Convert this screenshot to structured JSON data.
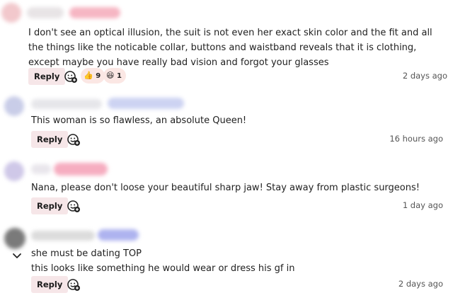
{
  "comments": [
    {
      "text": "I don't see an optical illusion, the suit is not even her exact skin color and the fit and all the things like the noticable collar, buttons and waistband reveals that it is clothing, except maybe you have really bad vision and forgot your glasses",
      "reply_label": "Reply",
      "reactions": [
        {
          "emoji": "👍",
          "count": "9",
          "icon": "thumbs-up-icon"
        },
        {
          "emoji": "😆",
          "count": "1",
          "icon": "laughing-face-icon"
        }
      ],
      "time": "2 days ago",
      "avatar_color": "#f2c8cc",
      "name_color": "#f08aa0"
    },
    {
      "text": "This woman is so flawless, an absolute Queen!",
      "reply_label": "Reply",
      "time": "16 hours ago",
      "avatar_color": "#c9cde8",
      "name_color": "#b8c0ea"
    },
    {
      "text": "Nana, please don't loose your beautiful sharp jaw! Stay away from plastic surgeons!",
      "reply_label": "Reply",
      "time": "1 day ago",
      "avatar_color": "#cfc8e8",
      "name_color": "#f3a3ba"
    },
    {
      "text": "she must be dating TOP\nthis looks like something he would wear or dress his gf in",
      "reply_label": "Reply",
      "time": "2 days ago",
      "avatar_color": "#7a7a7a",
      "name_color": "#a6aaea",
      "collapse_icon": "chevron-down-icon"
    }
  ],
  "icons": {
    "add_reaction": "add-reaction-icon"
  }
}
